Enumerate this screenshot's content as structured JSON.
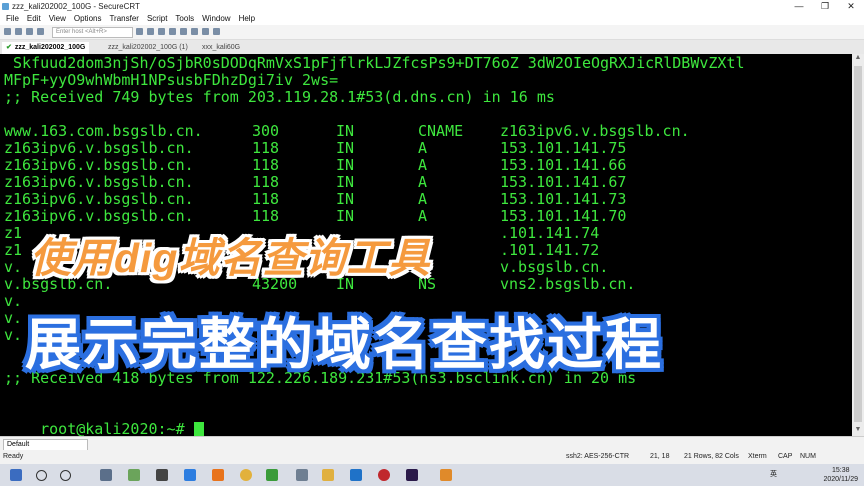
{
  "window": {
    "title": "zzz_kali202002_100G - SecureCRT",
    "controls": [
      "—",
      "❐",
      "✕"
    ]
  },
  "menu": [
    "File",
    "Edit",
    "View",
    "Options",
    "Transfer",
    "Script",
    "Tools",
    "Window",
    "Help"
  ],
  "toolbar": {
    "host_placeholder": "Enter host <Alt+R>"
  },
  "tabs": [
    {
      "label": "zzz_kali202002_100G",
      "active": true,
      "mark": "✔"
    },
    {
      "label": "zzz_kali202002_100G (1)",
      "active": false,
      "mark": ""
    },
    {
      "label": "xxx_kali60G",
      "active": false,
      "mark": ""
    }
  ],
  "terminal": {
    "top_lines": [
      " Skfuud2dom3njSh/oSjbR0sDODqRmVxS1pFjflrkLJZfcsPs9+DT76oZ 3dW2OIeOgRXJicRlDBWvZXtl",
      "MFpF+yyO9whWbmH1NPsusbFDhzDgi7iv 2ws=",
      ";; Received 749 bytes from 203.119.28.1#53(d.dns.cn) in 16 ms"
    ],
    "records": [
      {
        "name": "www.163.com.bsgslb.cn.",
        "ttl": "300",
        "class": "IN",
        "type": "CNAME",
        "data": "z163ipv6.v.bsgslb.cn."
      },
      {
        "name": "z163ipv6.v.bsgslb.cn.",
        "ttl": "118",
        "class": "IN",
        "type": "A",
        "data": "153.101.141.75"
      },
      {
        "name": "z163ipv6.v.bsgslb.cn.",
        "ttl": "118",
        "class": "IN",
        "type": "A",
        "data": "153.101.141.66"
      },
      {
        "name": "z163ipv6.v.bsgslb.cn.",
        "ttl": "118",
        "class": "IN",
        "type": "A",
        "data": "153.101.141.67"
      },
      {
        "name": "z163ipv6.v.bsgslb.cn.",
        "ttl": "118",
        "class": "IN",
        "type": "A",
        "data": "153.101.141.73"
      },
      {
        "name": "z163ipv6.v.bsgslb.cn.",
        "ttl": "118",
        "class": "IN",
        "type": "A",
        "data": "153.101.141.70"
      },
      {
        "name": "z1",
        "ttl": "",
        "class": "",
        "type": "",
        "data": ".101.141.74"
      },
      {
        "name": "z1",
        "ttl": "",
        "class": "",
        "type": "",
        "data": ".101.141.72"
      },
      {
        "name": "v.",
        "ttl": "",
        "class": "",
        "type": "",
        "data": "v.bsgslb.cn."
      },
      {
        "name": "v.bsgslb.cn.",
        "ttl": "43200",
        "class": "IN",
        "type": "NS",
        "data": "vns2.bsgslb.cn."
      },
      {
        "name": "v.",
        "ttl": "",
        "class": "",
        "type": "",
        "data": ""
      },
      {
        "name": "v.",
        "ttl": "",
        "class": "",
        "type": "",
        "data": ""
      },
      {
        "name": "v.",
        "ttl": "",
        "class": "",
        "type": "",
        "data": ""
      }
    ],
    "received_line": ";; Received 418 bytes from 122.226.189.231#53(ns3.bsclink.cn) in 20 ms",
    "prompt": "root@kali2020:~# "
  },
  "overlay": {
    "line1": "使用dig域名查询工具",
    "line2": "展示完整的域名查找过程"
  },
  "session_bar": {
    "selected": "Default"
  },
  "status": {
    "left": "Ready",
    "ssh": "ssh2: AES-256-CTR",
    "cursor": "21, 18",
    "size": "21 Rows, 82 Cols",
    "term": "Xterm",
    "caps": "CAP",
    "num": "NUM"
  },
  "taskbar": {
    "ime": "英",
    "time": "15:38",
    "date": "2020/11/29"
  },
  "colors": {
    "terminal_bg": "#000000",
    "terminal_fg": "#3ee63e",
    "overlay1": "#f59a3e",
    "overlay2_stroke": "#2b6fe0"
  }
}
